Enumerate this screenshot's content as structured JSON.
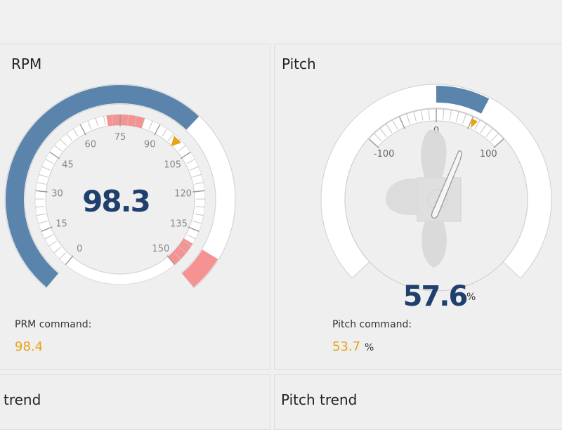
{
  "colors": {
    "accent": "#5b84ad",
    "warning_band": "#f59393",
    "marker": "#e8a317",
    "value_text": "#1f3f6e",
    "command_text": "#e8a317"
  },
  "rpm_gauge": {
    "title": "RPM",
    "value": "98.3",
    "value_number": 98.3,
    "scale_min": 0,
    "scale_max": 150,
    "tick_labels": [
      "0",
      "15",
      "30",
      "45",
      "60",
      "75",
      "90",
      "105",
      "120",
      "135",
      "150"
    ],
    "command_label": "PRM  command:",
    "command_value": "98.4",
    "command_number": 98.4,
    "warning_bands": [
      [
        70,
        84
      ],
      [
        140,
        150
      ]
    ]
  },
  "pitch_gauge": {
    "title": "Pitch",
    "value": "57.6",
    "value_number": 57.6,
    "unit": "%",
    "tick_labels": [
      "-100",
      "0",
      "100"
    ],
    "command_label": "Pitch  command:",
    "command_value": "53.7",
    "command_number": 53.7,
    "command_unit": "%",
    "icon": "propeller-icon"
  },
  "rpm_trend": {
    "title": "trend"
  },
  "pitch_trend": {
    "title": "Pitch  trend"
  }
}
